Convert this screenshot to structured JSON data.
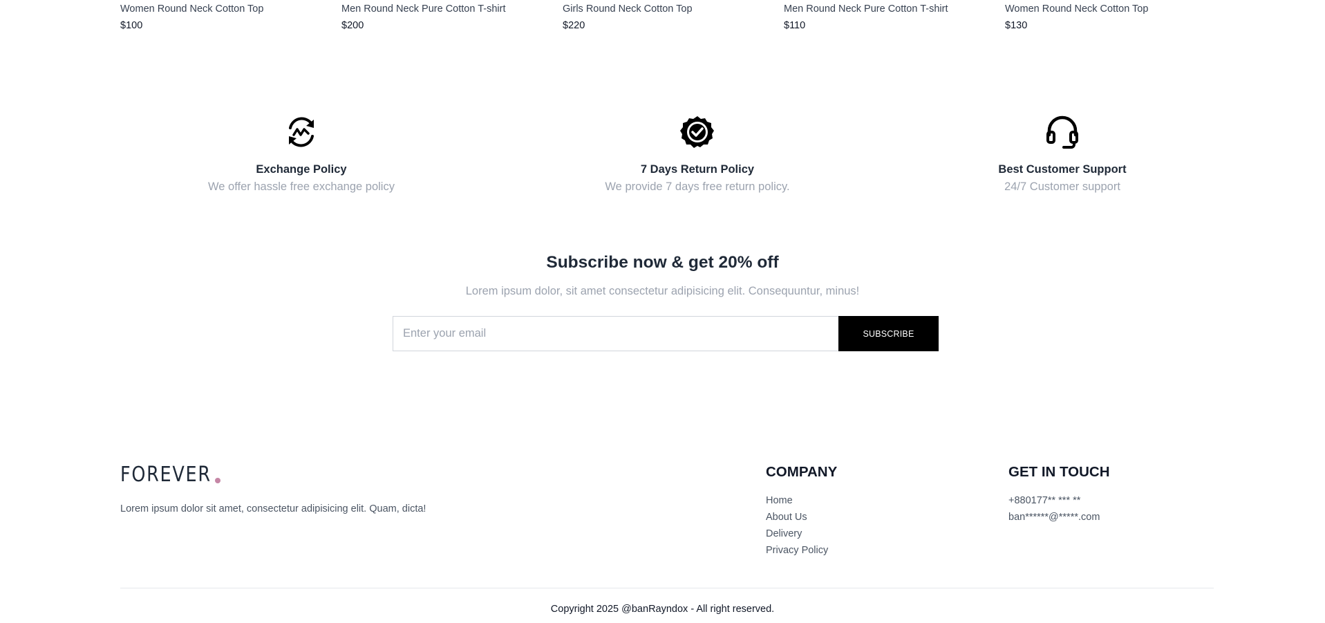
{
  "products": [
    {
      "name": "Women Round Neck Cotton Top",
      "price": "$100"
    },
    {
      "name": "Men Round Neck Pure Cotton T-shirt",
      "price": "$200"
    },
    {
      "name": "Girls Round Neck Cotton Top",
      "price": "$220"
    },
    {
      "name": "Men Round Neck Pure Cotton T-shirt",
      "price": "$110"
    },
    {
      "name": "Women Round Neck Cotton Top",
      "price": "$130"
    }
  ],
  "policies": [
    {
      "icon": "exchange-icon",
      "title": "Exchange Policy",
      "description": "We offer hassle free exchange policy"
    },
    {
      "icon": "quality-badge-icon",
      "title": "7 Days Return Policy",
      "description": "We provide 7 days free return policy."
    },
    {
      "icon": "headset-icon",
      "title": "Best Customer Support",
      "description": "24/7 Customer support"
    }
  ],
  "subscribe": {
    "title": "Subscribe now & get 20% off",
    "description": "Lorem ipsum dolor, sit amet consectetur adipisicing elit. Consequuntur, minus!",
    "placeholder": "Enter your email",
    "button_label": "SUBSCRIBE"
  },
  "footer": {
    "logo_text": "FOREVER",
    "logo_dot_color": "#c586a5",
    "about": "Lorem ipsum dolor sit amet, consectetur adipisicing elit. Quam, dicta!",
    "company": {
      "title": "COMPANY",
      "links": [
        "Home",
        "About Us",
        "Delivery",
        "Privacy Policy"
      ]
    },
    "contact": {
      "title": "GET IN TOUCH",
      "phone": "+880177** *** **",
      "email": "ban******@*****.com"
    },
    "copyright": "Copyright 2025 @banRayndox - All right reserved."
  }
}
